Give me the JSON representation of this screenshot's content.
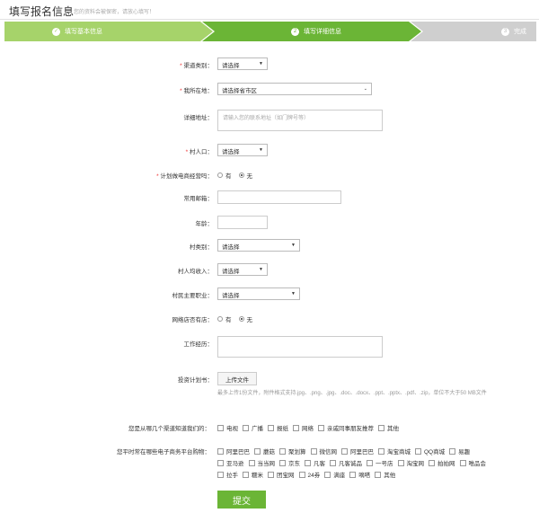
{
  "header": {
    "title": "填写报名信息",
    "subtitle": "您的资料会被保密，请放心填写！"
  },
  "steps": [
    {
      "icon": "check-icon",
      "label": "填写基本信息"
    },
    {
      "number": "2",
      "label": "填写详细信息"
    },
    {
      "number": "3",
      "label": "完成"
    }
  ],
  "form": {
    "channel": {
      "label": "渠道类别：",
      "required": "*",
      "value": "请选择"
    },
    "location": {
      "label": "我所在地：",
      "required": "*",
      "value": "请选择省市区"
    },
    "address": {
      "label": "详细地址：",
      "placeholder": "请输入您的联系地址（如门牌号等）"
    },
    "population": {
      "label": "村人口：",
      "required": "*",
      "value": "请选择"
    },
    "experience": {
      "label": "计划做电商经营吗：",
      "required": "*",
      "options": [
        "有",
        "无"
      ],
      "selected": "无"
    },
    "email": {
      "label": "常用邮箱：",
      "value": ""
    },
    "age": {
      "label": "年龄：",
      "value": ""
    },
    "village_type": {
      "label": "村类别：",
      "value": "请选择"
    },
    "income": {
      "label": "村人均收入：",
      "value": "请选择"
    },
    "industry": {
      "label": "村民主要职业：",
      "value": "请选择"
    },
    "shop": {
      "label": "网络店否有店：",
      "options": [
        "有",
        "无"
      ],
      "selected": "无"
    },
    "job": {
      "label": "工作经历：",
      "value": ""
    },
    "plan": {
      "label": "投资计划书：",
      "button": "上传文件",
      "hint": "最多上传1份文件，附件格式支持.jpg、.png、.jpg、.doc、.docx、.ppt、.pptx、.pdf、.zip，单位不大于50 MB文件"
    },
    "source": {
      "label": "您是从哪几个渠道知道我们的：",
      "options": [
        "电视",
        "广播",
        "报纸",
        "网络",
        "亲戚同事朋友推荐",
        "其他"
      ]
    },
    "platforms": {
      "label": "您平时常在哪些电子商务平台购物：",
      "rows": [
        [
          "阿里巴巴",
          "蘑菇",
          "聚划算",
          "微信网",
          "阿里巴巴",
          "淘宝商城",
          "QQ商城",
          "易趣"
        ],
        [
          "亚马逊",
          "当当网",
          "京东",
          "凡客",
          "凡客诚品",
          "一号店",
          "淘宝网",
          "拍拍网",
          "唯品会"
        ],
        [
          "拉手",
          "糯米",
          "团宝网",
          "24券",
          "满座",
          "嘀嗒",
          "其他"
        ]
      ]
    },
    "submit": "提交"
  },
  "colors": {
    "primary": "#6bb536",
    "done": "#a6d36a",
    "pending": "#cfcfcf"
  }
}
